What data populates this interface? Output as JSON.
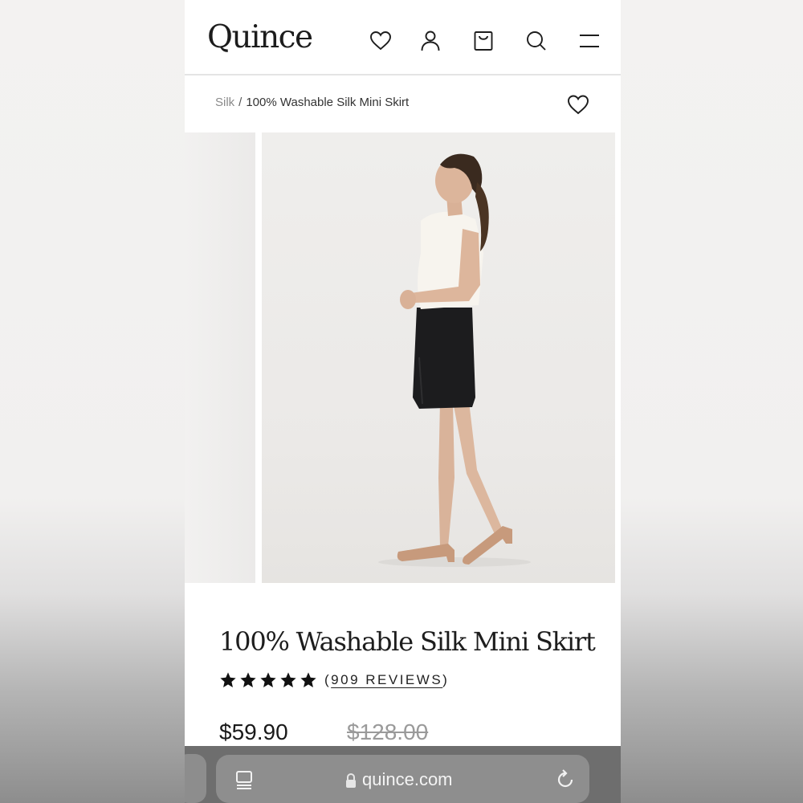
{
  "header": {
    "logo": "Quince",
    "icons": [
      "heart-icon",
      "account-icon",
      "bag-icon",
      "search-icon",
      "menu-icon"
    ]
  },
  "breadcrumb": {
    "parent": "Silk",
    "separator": "/",
    "current": "100% Washable Silk Mini Skirt"
  },
  "product": {
    "title": "100% Washable Silk Mini Skirt",
    "rating_stars": 5,
    "reviews_open": "(",
    "reviews_count": "909 REVIEWS",
    "reviews_close": ")",
    "price": "$59.90",
    "original_price": "$128.00"
  },
  "browser": {
    "url": "quince.com"
  },
  "colors": {
    "text": "#1d1d1d",
    "muted": "#9a9a9a",
    "browser_bar": "#6e6e6e",
    "url_pill": "#8e8e8e"
  }
}
